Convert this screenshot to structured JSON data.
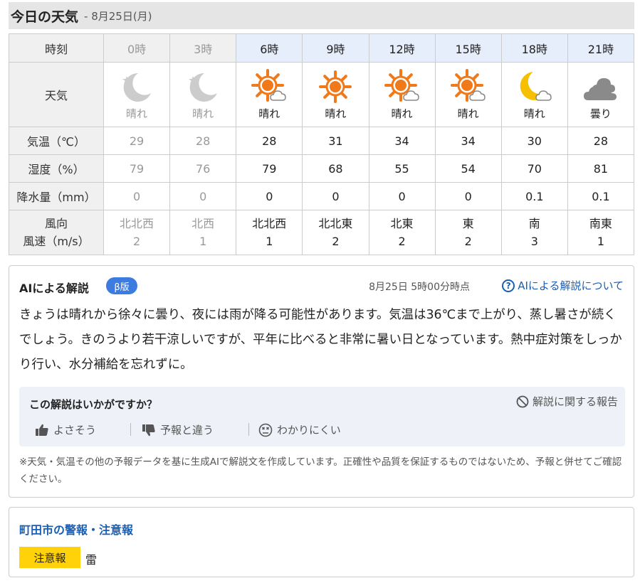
{
  "header": {
    "title": "今日の天気",
    "date": "- 8月25日(月)"
  },
  "table": {
    "labels": {
      "time": "時刻",
      "weather": "天気",
      "temp": "気温（℃）",
      "humidity": "湿度（%）",
      "rain": "降水量（mm）",
      "wind_dir": "風向",
      "wind_speed": "風速（m/s）"
    },
    "columns": [
      {
        "time": "0時",
        "icon": "moon-star-icon",
        "weather": "晴れ",
        "temp": "29",
        "humidity": "79",
        "rain": "0",
        "wind_dir": "北北西",
        "wind_speed": "2"
      },
      {
        "time": "3時",
        "icon": "moon-star-icon",
        "weather": "晴れ",
        "temp": "28",
        "humidity": "76",
        "rain": "0",
        "wind_dir": "北西",
        "wind_speed": "1"
      },
      {
        "time": "6時",
        "icon": "sun-cloud-icon",
        "weather": "晴れ",
        "temp": "28",
        "humidity": "79",
        "rain": "0",
        "wind_dir": "北北西",
        "wind_speed": "1"
      },
      {
        "time": "9時",
        "icon": "sun-icon",
        "weather": "晴れ",
        "temp": "31",
        "humidity": "68",
        "rain": "0",
        "wind_dir": "北北東",
        "wind_speed": "2"
      },
      {
        "time": "12時",
        "icon": "sun-cloud-icon",
        "weather": "晴れ",
        "temp": "34",
        "humidity": "55",
        "rain": "0",
        "wind_dir": "北東",
        "wind_speed": "2"
      },
      {
        "time": "15時",
        "icon": "sun-cloud-icon",
        "weather": "晴れ",
        "temp": "34",
        "humidity": "54",
        "rain": "0",
        "wind_dir": "東",
        "wind_speed": "2"
      },
      {
        "time": "18時",
        "icon": "moon-cloud-icon",
        "weather": "晴れ",
        "temp": "30",
        "humidity": "70",
        "rain": "0.1",
        "wind_dir": "南",
        "wind_speed": "3"
      },
      {
        "time": "21時",
        "icon": "cloud-icon",
        "weather": "曇り",
        "temp": "28",
        "humidity": "81",
        "rain": "0.1",
        "wind_dir": "南東",
        "wind_speed": "1"
      }
    ]
  },
  "ai": {
    "title": "AIによる解説",
    "badge": "β版",
    "timestamp": "8月25日 5時00分時点",
    "about_link": "AIによる解説について",
    "text": "きょうは晴れから徐々に曇り、夜には雨が降る可能性があります。気温は36℃まで上がり、蒸し暑さが続くでしょう。きのうより若干涼しいですが、平年に比べると非常に暑い日となっています。熱中症対策をしっかり行い、水分補給を忘れずに。",
    "feedback": {
      "question": "この解説はいかがですか？",
      "report": "解説に関する報告",
      "good": "よさそう",
      "different": "予報と違う",
      "unclear": "わかりにくい"
    },
    "note": "※天気・気温その他の予報データを基に生成AIで解説文を作成しています。正確性や品質を保証するものではないため、予報と併せてご確認ください。"
  },
  "warnings": {
    "title": "町田市の警報・注意報",
    "level": "注意報",
    "item": "雷"
  },
  "colors": {
    "accent": "#3c7be0",
    "link": "#1a5fb4",
    "warning_badge": "#ffd20a",
    "sun": "#f07a1a",
    "moon": "#f6c000"
  }
}
